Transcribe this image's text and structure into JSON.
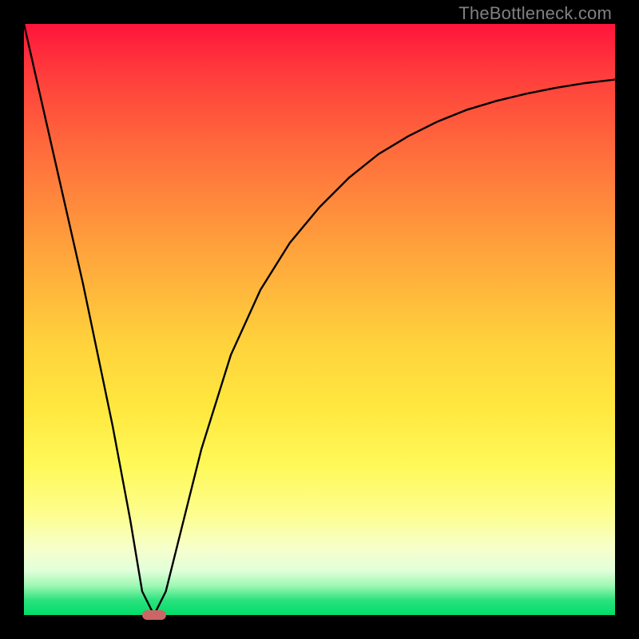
{
  "watermark": "TheBottleneck.com",
  "chart_data": {
    "type": "line",
    "title": "",
    "xlabel": "",
    "ylabel": "",
    "xlim": [
      0,
      100
    ],
    "ylim": [
      0,
      100
    ],
    "series": [
      {
        "name": "curve",
        "x": [
          0,
          5,
          10,
          15,
          18,
          20,
          22,
          24,
          26,
          30,
          35,
          40,
          45,
          50,
          55,
          60,
          65,
          70,
          75,
          80,
          85,
          90,
          95,
          100
        ],
        "y": [
          100,
          78,
          56,
          32,
          16,
          4,
          0,
          4,
          12,
          28,
          44,
          55,
          63,
          69,
          74,
          78,
          81,
          83.5,
          85.5,
          87,
          88.2,
          89.2,
          90,
          90.6
        ]
      }
    ],
    "marker": {
      "x_center": 22,
      "width": 4
    },
    "gradient_stops": [
      {
        "pos": 0,
        "color": "#ff143c"
      },
      {
        "pos": 0.5,
        "color": "#ffd23c"
      },
      {
        "pos": 0.85,
        "color": "#fdfe8f"
      },
      {
        "pos": 1.0,
        "color": "#00dd6a"
      }
    ]
  }
}
